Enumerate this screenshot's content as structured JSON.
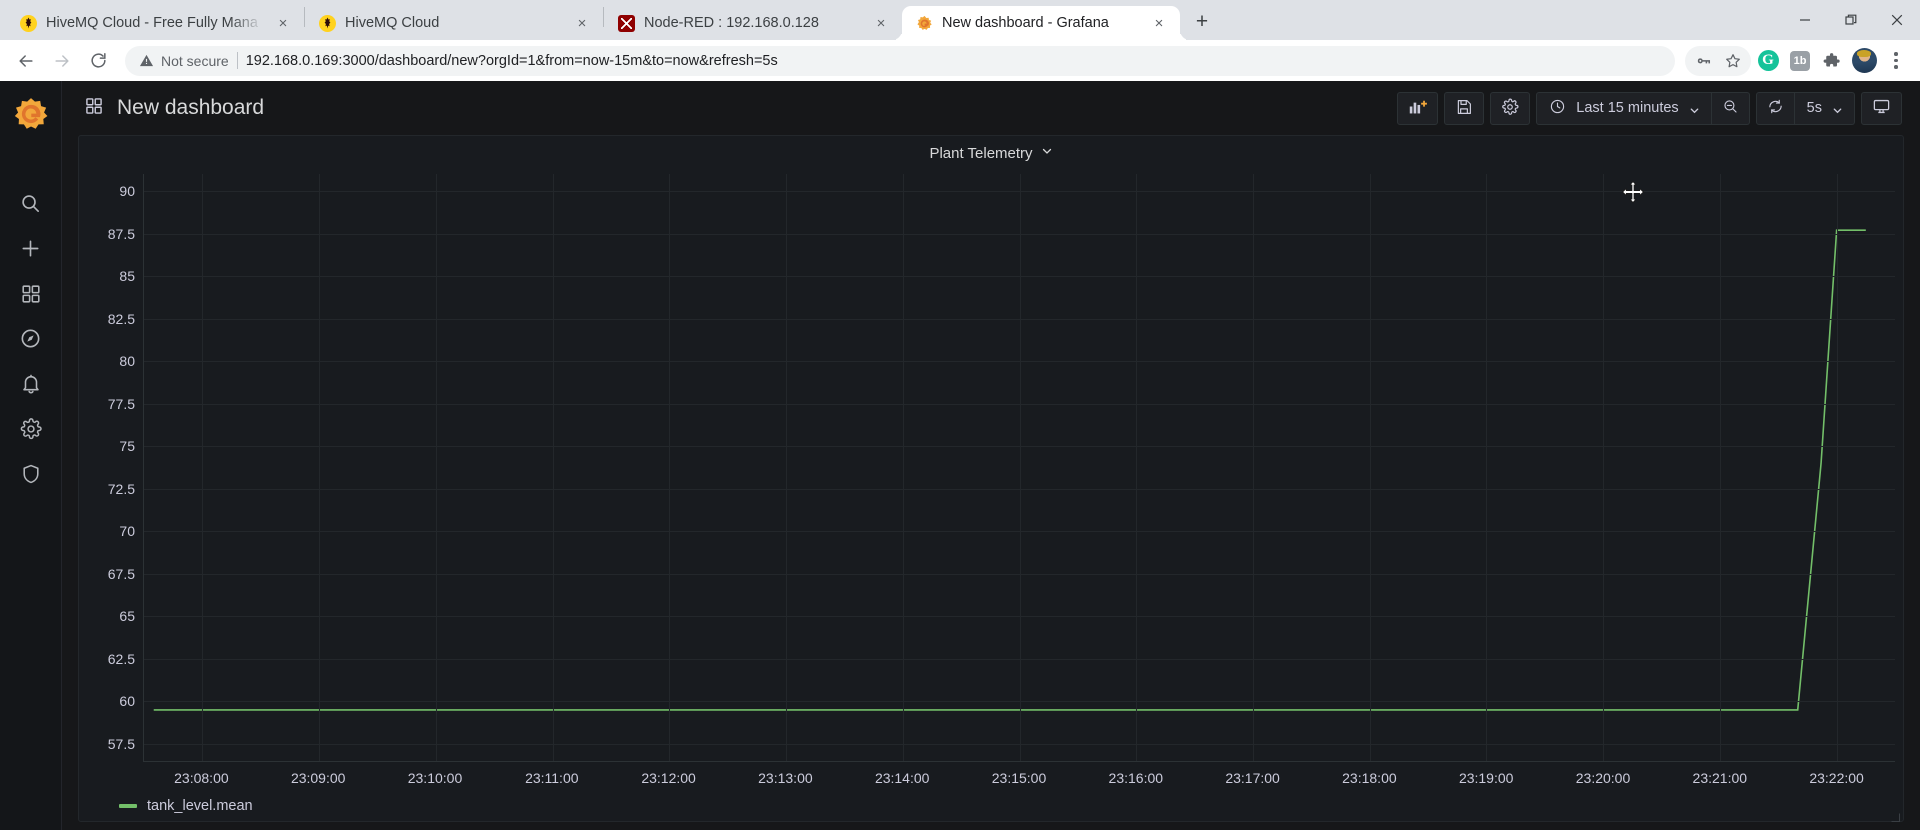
{
  "browser": {
    "tabs": [
      {
        "title": "HiveMQ Cloud - Free Fully Mana",
        "favicon": "hivemq-icon",
        "active": false,
        "close_label": "×"
      },
      {
        "title": "HiveMQ Cloud",
        "favicon": "hivemq-icon",
        "active": false,
        "close_label": "×"
      },
      {
        "title": "Node-RED : 192.168.0.128",
        "favicon": "node-red-icon",
        "active": false,
        "close_label": "×"
      },
      {
        "title": "New dashboard - Grafana",
        "favicon": "grafana-icon",
        "active": true,
        "close_label": "×"
      }
    ],
    "new_tab_label": "+",
    "window_controls": {
      "minimize": "minimize-icon",
      "maximize": "restore-icon",
      "close": "close-icon"
    },
    "nav": {
      "back": "back-arrow-icon",
      "forward": "forward-arrow-icon",
      "reload": "reload-icon"
    },
    "security_label": "Not secure",
    "url": "192.168.0.169:3000/dashboard/new?orgId=1&from=now-15m&to=now&refresh=5s",
    "omnibox_icons": [
      "password-key-icon",
      "bookmark-star-icon",
      "grammarly-extension-icon",
      "onetab-extension-icon",
      "extensions-puzzle-icon",
      "profile-avatar",
      "chrome-menu-icon"
    ],
    "extension_badges": {
      "grammarly": "G",
      "onetab": "1b"
    }
  },
  "sidebar": {
    "logo": "grafana-logo",
    "items": [
      {
        "name": "search",
        "icon": "search-icon"
      },
      {
        "name": "create",
        "icon": "plus-icon"
      },
      {
        "name": "dashboards",
        "icon": "apps-grid-icon"
      },
      {
        "name": "explore",
        "icon": "compass-icon"
      },
      {
        "name": "alerting",
        "icon": "bell-icon"
      },
      {
        "name": "configuration",
        "icon": "gear-icon"
      },
      {
        "name": "server-admin",
        "icon": "shield-icon"
      }
    ]
  },
  "toolbar": {
    "dashboard_icon": "dashboard-grid-icon",
    "title": "New dashboard",
    "add_panel_label": "add-panel-icon",
    "save_label": "save-dashboard-icon",
    "settings_label": "dashboard-settings-icon",
    "time_range": "Last 15 minutes",
    "time_picker_icon": "clock-icon",
    "zoom_out_label": "zoom-out-icon",
    "refresh_label": "refresh-icon",
    "refresh_interval": "5s",
    "kiosk_label": "tv-kiosk-icon"
  },
  "panel": {
    "title": "Plant Telemetry",
    "menu_icon": "chevron-down-icon"
  },
  "chart_data": {
    "type": "line",
    "title": "Plant Telemetry",
    "xlabel": "",
    "ylabel": "",
    "grid": true,
    "legend_position": "bottom-left",
    "ylim": [
      56.5,
      91.0
    ],
    "yticks": [
      90,
      87.5,
      85,
      82.5,
      80,
      77.5,
      75,
      72.5,
      70,
      67.5,
      65,
      62.5,
      60,
      57.5
    ],
    "ytick_labels": [
      "90",
      "87.5",
      "85",
      "82.5",
      "80",
      "77.5",
      "75",
      "72.5",
      "70",
      "67.5",
      "65",
      "62.5",
      "60",
      "57.5"
    ],
    "xticks": [
      "23:08:00",
      "23:09:00",
      "23:10:00",
      "23:11:00",
      "23:12:00",
      "23:13:00",
      "23:14:00",
      "23:15:00",
      "23:16:00",
      "23:17:00",
      "23:18:00",
      "23:19:00",
      "23:20:00",
      "23:21:00",
      "23:22:00"
    ],
    "xlim": [
      "23:07:30",
      "23:22:30"
    ],
    "series": [
      {
        "name": "tank_level.mean",
        "color": "#73bf69",
        "x": [
          "23:07:35",
          "23:08:00",
          "23:09:00",
          "23:10:00",
          "23:11:00",
          "23:12:00",
          "23:13:00",
          "23:14:00",
          "23:15:00",
          "23:16:00",
          "23:17:00",
          "23:18:00",
          "23:19:00",
          "23:20:00",
          "23:21:00",
          "23:21:40",
          "23:21:52",
          "23:22:00",
          "23:22:15"
        ],
        "values": [
          59.5,
          59.5,
          59.5,
          59.5,
          59.5,
          59.5,
          59.5,
          59.5,
          59.5,
          59.5,
          59.5,
          59.5,
          59.5,
          59.5,
          59.5,
          59.5,
          74.0,
          87.7,
          87.7
        ]
      }
    ],
    "legend": [
      {
        "label": "tank_level.mean",
        "color": "#73bf69"
      }
    ]
  }
}
